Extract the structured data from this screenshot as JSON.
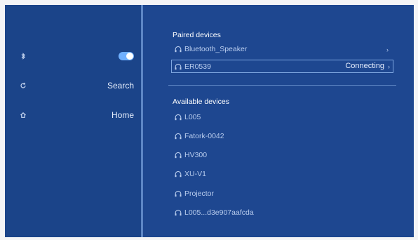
{
  "sidebar": {
    "bluetooth_icon": "bluetooth-icon",
    "search": {
      "label": "Search",
      "icon": "refresh-icon"
    },
    "home": {
      "label": "Home",
      "icon": "home-icon"
    },
    "bluetooth_toggle_on": true
  },
  "paired": {
    "title": "Paired devices",
    "devices": [
      {
        "name": "Bluetooth_Speaker"
      },
      {
        "name": "ER0539",
        "status": "Connecting"
      }
    ]
  },
  "available": {
    "title": "Available devices",
    "devices": [
      {
        "name": "L005"
      },
      {
        "name": "Fatork-0042"
      },
      {
        "name": "HV300"
      },
      {
        "name": "XU-V1"
      },
      {
        "name": "Projector"
      },
      {
        "name": "L005...d3e907aafcda"
      }
    ]
  },
  "colors": {
    "background": "#1e4790",
    "sidebar": "#1b4489",
    "accent": "#6fb0ff",
    "text": "#b9cdee"
  }
}
